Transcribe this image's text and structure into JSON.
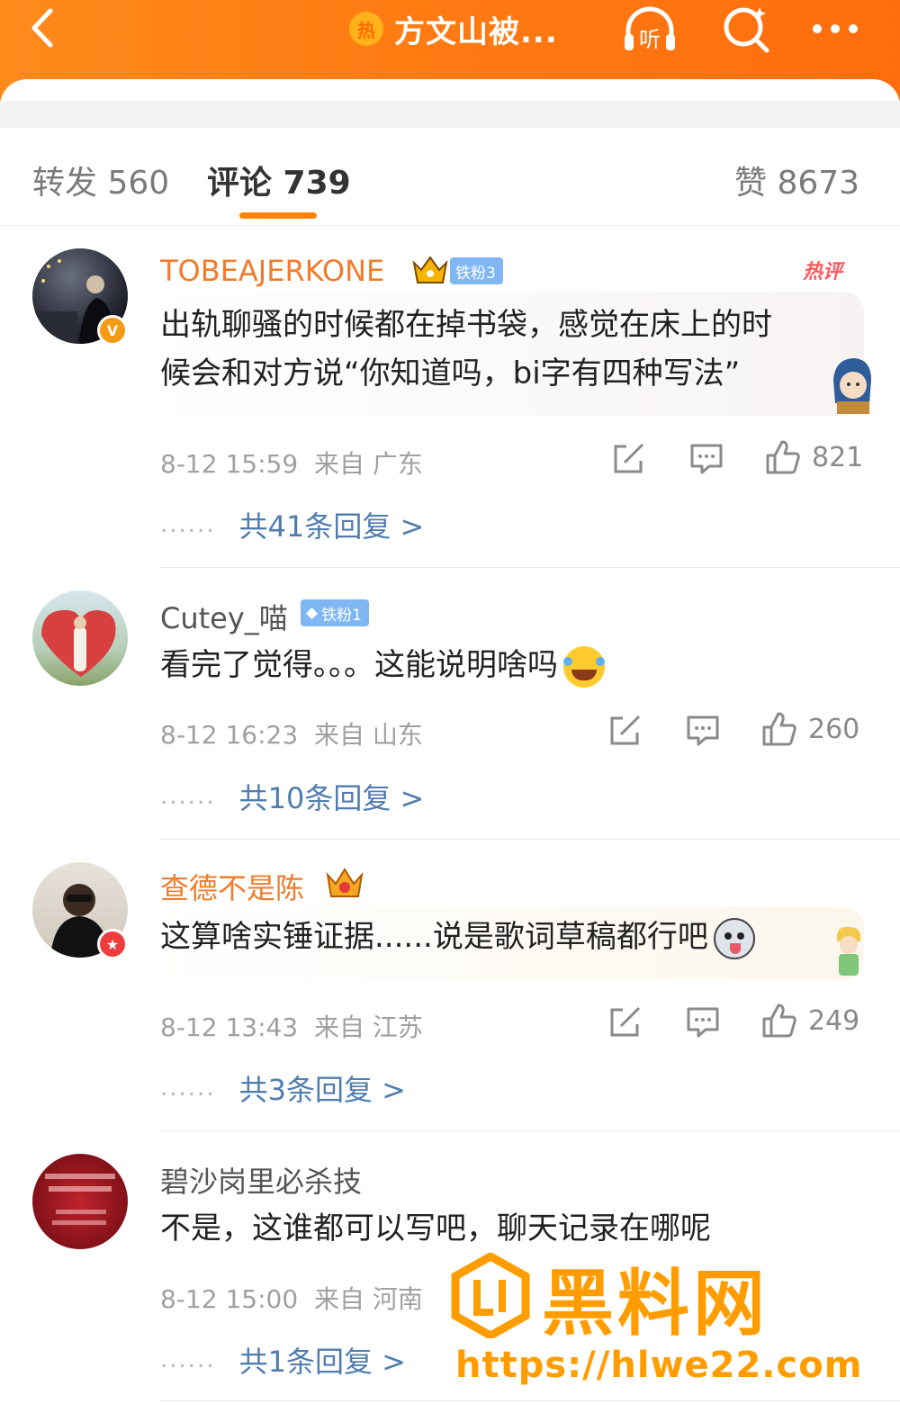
{
  "header": {
    "hot_badge": "热",
    "title": "方文山被...",
    "listen_label": "听",
    "back_icon": "chevron-left-icon",
    "search_icon": "search-icon",
    "more_icon": "more-horizontal-icon"
  },
  "tabs": {
    "repost": "转发 560",
    "comments": "评论 739",
    "likes": "赞 8673"
  },
  "comments": [
    {
      "username": "TOBEAJERKONE",
      "fan_badge": "铁粉3",
      "hot_tag": "热评",
      "content_line1": "出轨聊骚的时候都在掉书袋，感觉在床上的时",
      "content_line2": "候会和对方说“你知道吗，bi字有四种写法”",
      "time": "8-12 15:59",
      "location": "来自 广东",
      "likes": "821",
      "dots": "......",
      "replies": "共41条回复 >"
    },
    {
      "username": "Cutey_喵",
      "fan_badge": "铁粉1",
      "content_line1": "看完了觉得。。。这能说明啥吗",
      "time": "8-12 16:23",
      "location": "来自 山东",
      "likes": "260",
      "dots": "......",
      "replies": "共10条回复 >"
    },
    {
      "username": "查德不是陈",
      "content_line1": "这算啥实锤证据......说是歌词草稿都行吧",
      "time": "8-12 13:43",
      "location": "来自 江苏",
      "likes": "249",
      "dots": "......",
      "replies": "共3条回复 >"
    },
    {
      "username": "碧沙岗里必杀技",
      "content_line1": "不是，这谁都可以写吧，聊天记录在哪呢",
      "time": "8-12 15:00",
      "location": "来自 河南",
      "dots": "......",
      "replies": "共1条回复 >"
    }
  ],
  "watermark": {
    "text": "黑料网",
    "url": "https://hlwe22.com"
  },
  "colors": {
    "header_orange": "#ff7a12",
    "tab_underline": "#ff8200",
    "link_blue": "#507daf",
    "username_orange": "#f07c2c",
    "fan_badge_blue": "#7fb7f5",
    "watermark_orange": "#ff9d00"
  }
}
